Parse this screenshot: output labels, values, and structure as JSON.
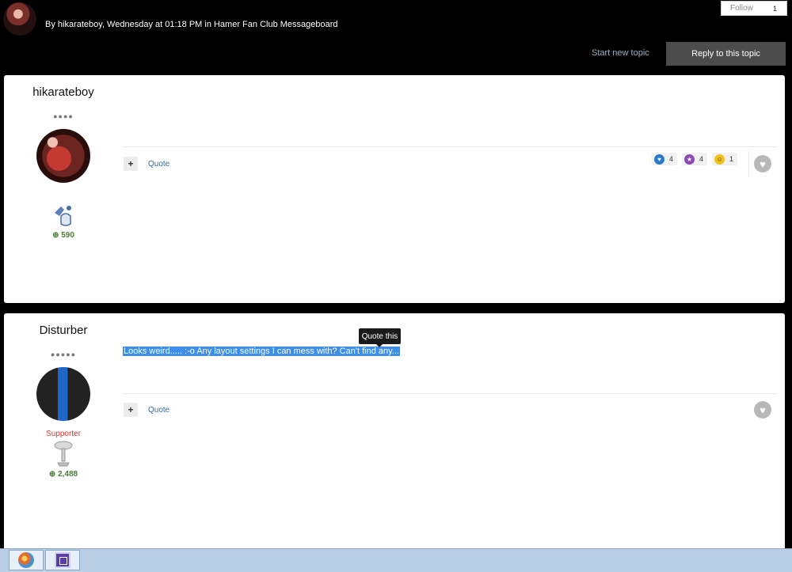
{
  "header": {
    "byline": "By hikarateboy, Wednesday at 01:18 PM in Hamer Fan Club Messageboard",
    "follow_label": "Follow",
    "follow_count": "1",
    "start_topic": "Start new topic",
    "reply": "Reply to this topic"
  },
  "posts": [
    {
      "author": "hikarateboy",
      "pips": "●●●●",
      "reputation": "590",
      "content": "",
      "quote": "Quote",
      "reactions": [
        {
          "icon": "like-icon",
          "count": "4"
        },
        {
          "icon": "thanks-icon",
          "count": "4"
        },
        {
          "icon": "haha-icon",
          "count": "1"
        }
      ]
    },
    {
      "author": "Disturber",
      "pips": "●●●●●",
      "group": "Supporter",
      "reputation": "2,488",
      "content": "Looks weird..... :-o  Any layout settings I can mess with? Can't find any...",
      "quote": "Quote"
    }
  ],
  "tooltip": "Quote this",
  "colors": {
    "page_background": "#000000",
    "reply_button": "#4c4c4c",
    "link": "#2d6ea6",
    "reputation": "#4a7d36",
    "supporter": "#d9342b",
    "selection": "#3d8ee8"
  }
}
